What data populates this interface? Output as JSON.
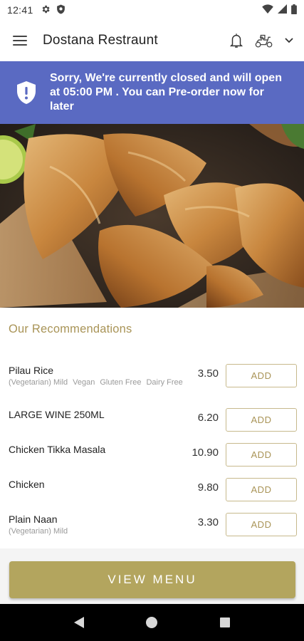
{
  "status_bar": {
    "time": "12:41",
    "left_icons": [
      "gear-icon",
      "shield-icon"
    ],
    "right_icons": [
      "wifi-icon",
      "signal-icon",
      "battery-icon"
    ]
  },
  "app_bar": {
    "title": "Dostana Restraunt",
    "icons": [
      "hamburger-menu-icon",
      "bell-icon",
      "delivery-scooter-icon",
      "chevron-down-icon"
    ]
  },
  "banner": {
    "message": "Sorry, We're currently closed and will open at 05:00 PM . You can Pre-order now for later",
    "icon": "alert-shield-icon",
    "color": "#5a6ac2"
  },
  "hero": {
    "icon": "samosa-food-photo"
  },
  "recommendations": {
    "title": "Our Recommendations",
    "add_label": "ADD",
    "items": [
      {
        "name": "Pilau Rice",
        "tags": [
          "(Vegetarian) Mild",
          "Vegan",
          "Gluten Free",
          "Dairy Free"
        ],
        "price": "3.50"
      },
      {
        "name": "LARGE WINE 250ML",
        "tags": [],
        "price": "6.20"
      },
      {
        "name": "Chicken Tikka Masala",
        "tags": [],
        "price": "10.90"
      },
      {
        "name": "Chicken",
        "tags": [],
        "price": "9.80"
      },
      {
        "name": "Plain Naan",
        "tags": [
          "(Vegetarian) Mild"
        ],
        "price": "3.30"
      }
    ]
  },
  "footer": {
    "view_menu_label": "VIEW MENU",
    "accent": "#b3a55e"
  },
  "nav_bar": {
    "icons": [
      "back-icon",
      "home-icon",
      "recents-icon"
    ]
  }
}
